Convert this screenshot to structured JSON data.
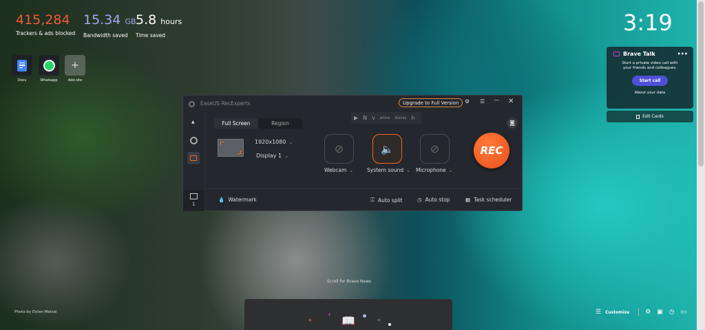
{
  "stats": [
    {
      "value": "415,284",
      "unit": "",
      "label": "Trackers & ads blocked",
      "color": "#f05a3a"
    },
    {
      "value": "15.34",
      "unit": "GB",
      "label": "Bandwidth saved",
      "color": "#a8a8f0"
    },
    {
      "value": "5.8",
      "unit": "hours",
      "label": "Time saved",
      "color": "#ffffff"
    }
  ],
  "top_sites": [
    {
      "label": "Docs"
    },
    {
      "label": "Whatsapp"
    },
    {
      "label": "Add site"
    }
  ],
  "clock": "3:19",
  "brave_talk": {
    "title": "Brave Talk",
    "description": "Start a private video call with your friends and colleagues.",
    "button": "Start call",
    "link": "About your data",
    "edit_cards": "Edit Cards"
  },
  "recorder": {
    "title": "EaseUS RecExperts",
    "upgrade": "Upgrade to Full Version",
    "tabs": [
      "Full Screen",
      "Region"
    ],
    "active_tab": "Full Screen",
    "resolution": "1920x1080",
    "display": "Display 1",
    "sources": [
      {
        "label": "Webcam",
        "state": "off"
      },
      {
        "label": "System sound",
        "state": "on"
      },
      {
        "label": "Microphone",
        "state": "off"
      }
    ],
    "rec_label": "REC",
    "recordings_count": "1",
    "watermark": "Watermark",
    "auto_split": "Auto split",
    "auto_stop": "Auto stop",
    "task_scheduler": "Task scheduler",
    "accent": "#f26a1b"
  },
  "photo_credit": "Photo by Dylan Malval",
  "news_hint": "Scroll for Brave News",
  "customize": "Customize"
}
